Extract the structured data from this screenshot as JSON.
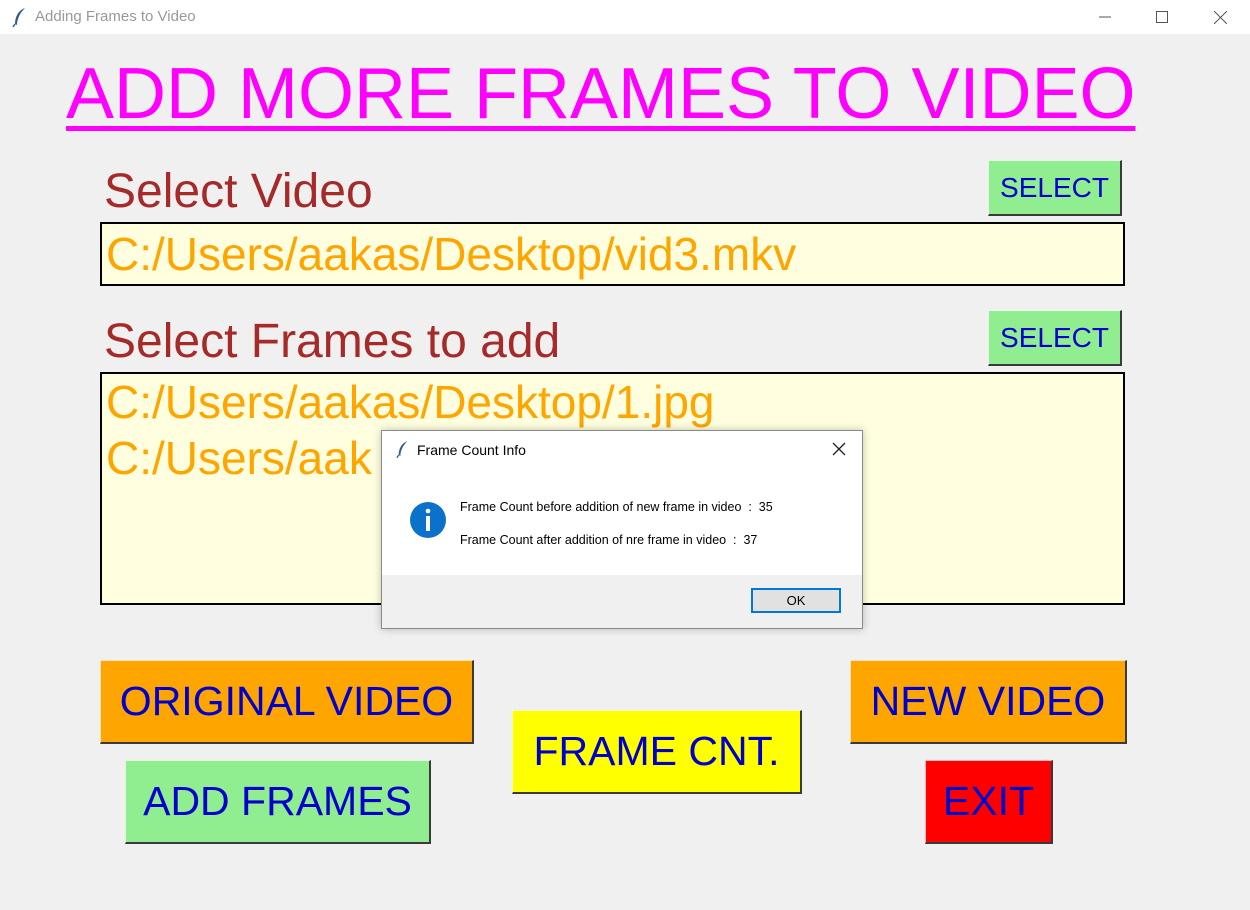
{
  "window": {
    "title": "Adding Frames to Video"
  },
  "heading": "ADD MORE FRAMES TO VIDEO",
  "video_section": {
    "label": "Select Video",
    "select_label": "SELECT",
    "path": "C:/Users/aakas/Desktop/vid3.mkv"
  },
  "frames_section": {
    "label": "Select Frames to add",
    "select_label": "SELECT",
    "paths": [
      "C:/Users/aakas/Desktop/1.jpg",
      "C:/Users/aak"
    ]
  },
  "buttons": {
    "original_video": "ORIGINAL VIDEO",
    "add_frames": "ADD FRAMES",
    "frame_count": "FRAME CNT.",
    "new_video": "NEW VIDEO",
    "exit": "EXIT"
  },
  "dialog": {
    "title": "Frame Count Info",
    "message_before": "Frame Count before addition of new frame in video  :  35",
    "message_after": "Frame Count after addition of nre frame in video  :  37",
    "ok_label": "OK"
  },
  "colors": {
    "heading": "#ff00ff",
    "label": "#a52a2a",
    "path_text": "#ffa500",
    "textbox_bg": "#ffffe0",
    "button_text": "#0000cd",
    "green": "#90ee90",
    "orange": "#ffa500",
    "yellow": "#ffff00",
    "red": "#ff0000"
  },
  "icons": {
    "app": "feather-icon",
    "minimize": "minimize-icon",
    "maximize": "maximize-icon",
    "close": "close-icon",
    "dialog_info": "info-icon"
  }
}
